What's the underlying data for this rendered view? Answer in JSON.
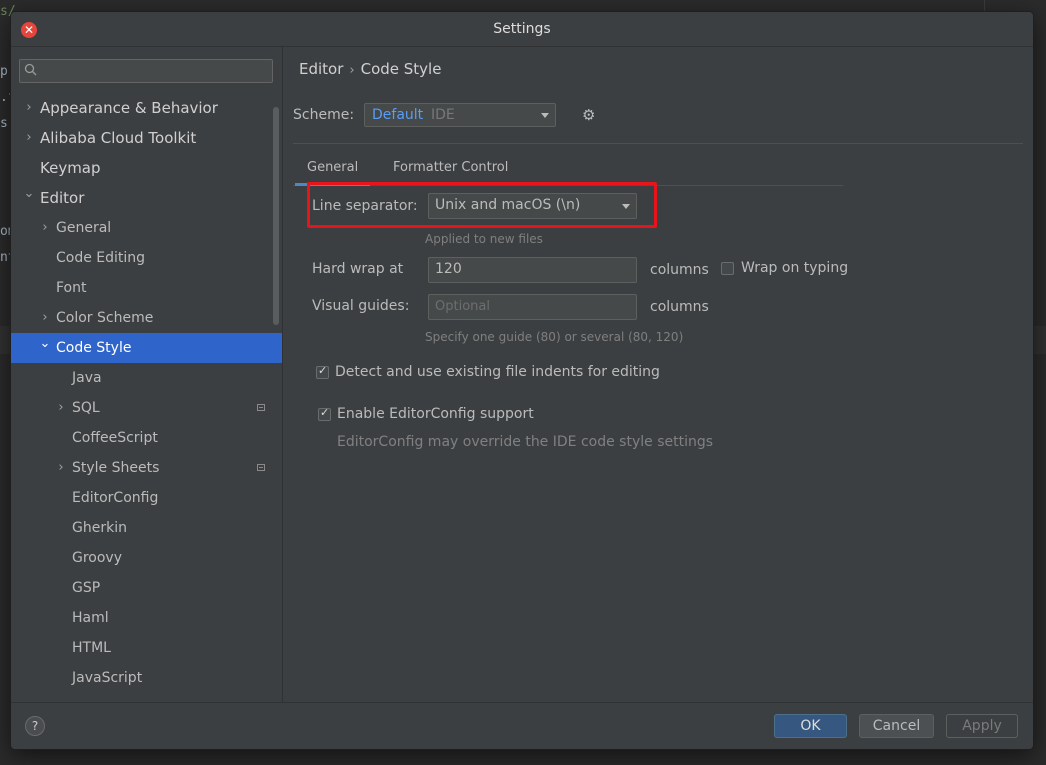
{
  "window": {
    "title": "Settings"
  },
  "background_code": {
    "lines": [
      "s/",
      "p",
      ".f",
      "s-",
      "om",
      "nt"
    ]
  },
  "search": {
    "placeholder": ""
  },
  "sidebar": {
    "items": [
      {
        "label": "Appearance & Behavior",
        "level": 0,
        "expandable": true,
        "expanded": false
      },
      {
        "label": "Alibaba Cloud Toolkit",
        "level": 0,
        "expandable": true,
        "expanded": false
      },
      {
        "label": "Keymap",
        "level": 0,
        "expandable": false
      },
      {
        "label": "Editor",
        "level": 0,
        "expandable": true,
        "expanded": true
      },
      {
        "label": "General",
        "level": 1,
        "expandable": true,
        "expanded": false
      },
      {
        "label": "Code Editing",
        "level": 1,
        "expandable": false
      },
      {
        "label": "Font",
        "level": 1,
        "expandable": false
      },
      {
        "label": "Color Scheme",
        "level": 1,
        "expandable": true,
        "expanded": false
      },
      {
        "label": "Code Style",
        "level": 1,
        "expandable": true,
        "expanded": true,
        "selected": true
      },
      {
        "label": "Java",
        "level": 2,
        "expandable": false
      },
      {
        "label": "SQL",
        "level": 2,
        "expandable": true,
        "expanded": false,
        "project_icon": true
      },
      {
        "label": "CoffeeScript",
        "level": 2,
        "expandable": false
      },
      {
        "label": "Style Sheets",
        "level": 2,
        "expandable": true,
        "expanded": false,
        "project_icon": true
      },
      {
        "label": "EditorConfig",
        "level": 2,
        "expandable": false
      },
      {
        "label": "Gherkin",
        "level": 2,
        "expandable": false
      },
      {
        "label": "Groovy",
        "level": 2,
        "expandable": false
      },
      {
        "label": "GSP",
        "level": 2,
        "expandable": false
      },
      {
        "label": "Haml",
        "level": 2,
        "expandable": false
      },
      {
        "label": "HTML",
        "level": 2,
        "expandable": false
      },
      {
        "label": "JavaScript",
        "level": 2,
        "expandable": false
      }
    ]
  },
  "breadcrumb": {
    "parent": "Editor",
    "separator": "›",
    "current": "Code Style"
  },
  "scheme": {
    "label": "Scheme:",
    "name": "Default",
    "kind": "IDE"
  },
  "tabs": [
    {
      "label": "General",
      "active": true
    },
    {
      "label": "Formatter Control",
      "active": false
    }
  ],
  "general": {
    "line_separator": {
      "label": "Line separator:",
      "value": "Unix and macOS (\\n)",
      "hint": "Applied to new files"
    },
    "hard_wrap": {
      "label": "Hard wrap at",
      "value": "120",
      "unit": "columns"
    },
    "wrap_on_typing": {
      "label": "Wrap on typing",
      "checked": false
    },
    "visual_guides": {
      "label": "Visual guides:",
      "placeholder": "Optional",
      "unit": "columns",
      "hint": "Specify one guide (80) or several (80, 120)"
    },
    "detect_indents": {
      "label": "Detect and use existing file indents for editing",
      "checked": true
    },
    "editorconfig": {
      "label": "Enable EditorConfig support",
      "checked": true,
      "note": "EditorConfig may override the IDE code style settings"
    }
  },
  "footer": {
    "help": "?",
    "ok": "OK",
    "cancel": "Cancel",
    "apply": "Apply"
  },
  "colors": {
    "accent": "#2f65ca",
    "highlight_box": "#e8141c",
    "scheme_name": "#589df6",
    "close": "#e5453a"
  }
}
